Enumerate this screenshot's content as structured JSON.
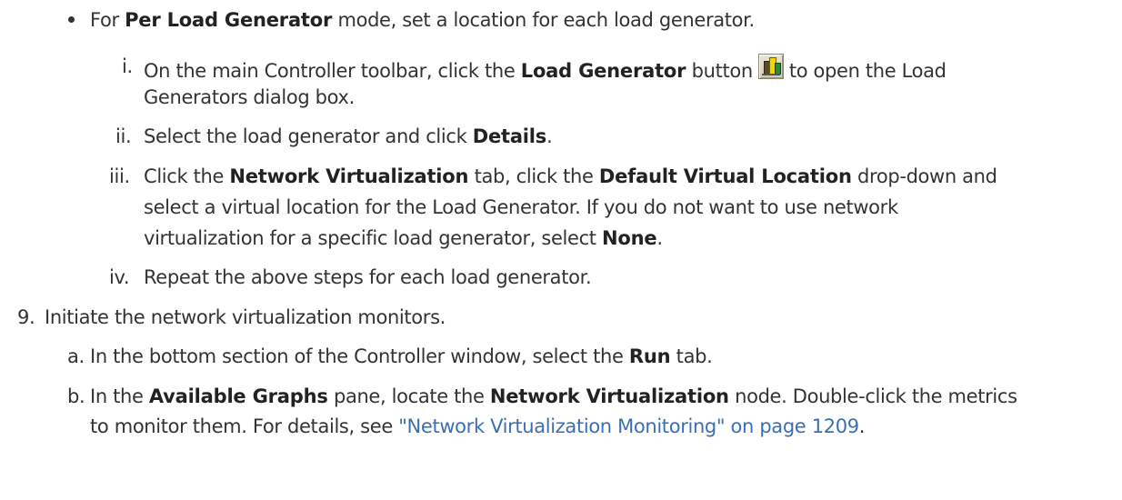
{
  "bullet_item": {
    "pre": "For ",
    "bold": "Per Load Generator",
    "post": " mode, set a location for each load generator."
  },
  "roman_steps": [
    {
      "marker": "i.",
      "line1_pre": "On the main Controller toolbar, click the ",
      "line1_bold": "Load Generator",
      "line1_mid": " button",
      "line1_post": "to open the Load",
      "line2": "Generators dialog box.",
      "icon": "load-generator-toolbar-icon"
    },
    {
      "marker": "ii.",
      "pre": "Select the load generator and click ",
      "bold": "Details",
      "post": "."
    },
    {
      "marker": "iii.",
      "line1_pre": "Click the ",
      "line1_bold1": "Network Virtualization",
      "line1_mid": " tab, click the ",
      "line1_bold2": "Default Virtual Location",
      "line1_post": " drop-down and",
      "line2": "select a virtual location for the Load Generator. If you do not want to use network",
      "line3_pre": "virtualization for a specific load generator, select ",
      "line3_bold": "None",
      "line3_post": "."
    },
    {
      "marker": "iv.",
      "text": "Repeat the above steps for each load generator."
    }
  ],
  "step9": {
    "marker": "9.",
    "text": "Initiate the network virtualization monitors."
  },
  "alpha_steps": [
    {
      "marker": "a.",
      "pre": "In the bottom section of the Controller window, select the ",
      "bold": "Run",
      "post": " tab."
    },
    {
      "marker": "b.",
      "line1_pre": "In the ",
      "line1_bold1": "Available Graphs",
      "line1_mid": " pane, locate the ",
      "line1_bold2": "Network Virtualization",
      "line1_post": " node. Double-click the metrics",
      "line2_pre": "to monitor them. For details, see ",
      "line2_link": "\"Network Virtualization Monitoring\" on page 1209",
      "line2_post": "."
    }
  ]
}
